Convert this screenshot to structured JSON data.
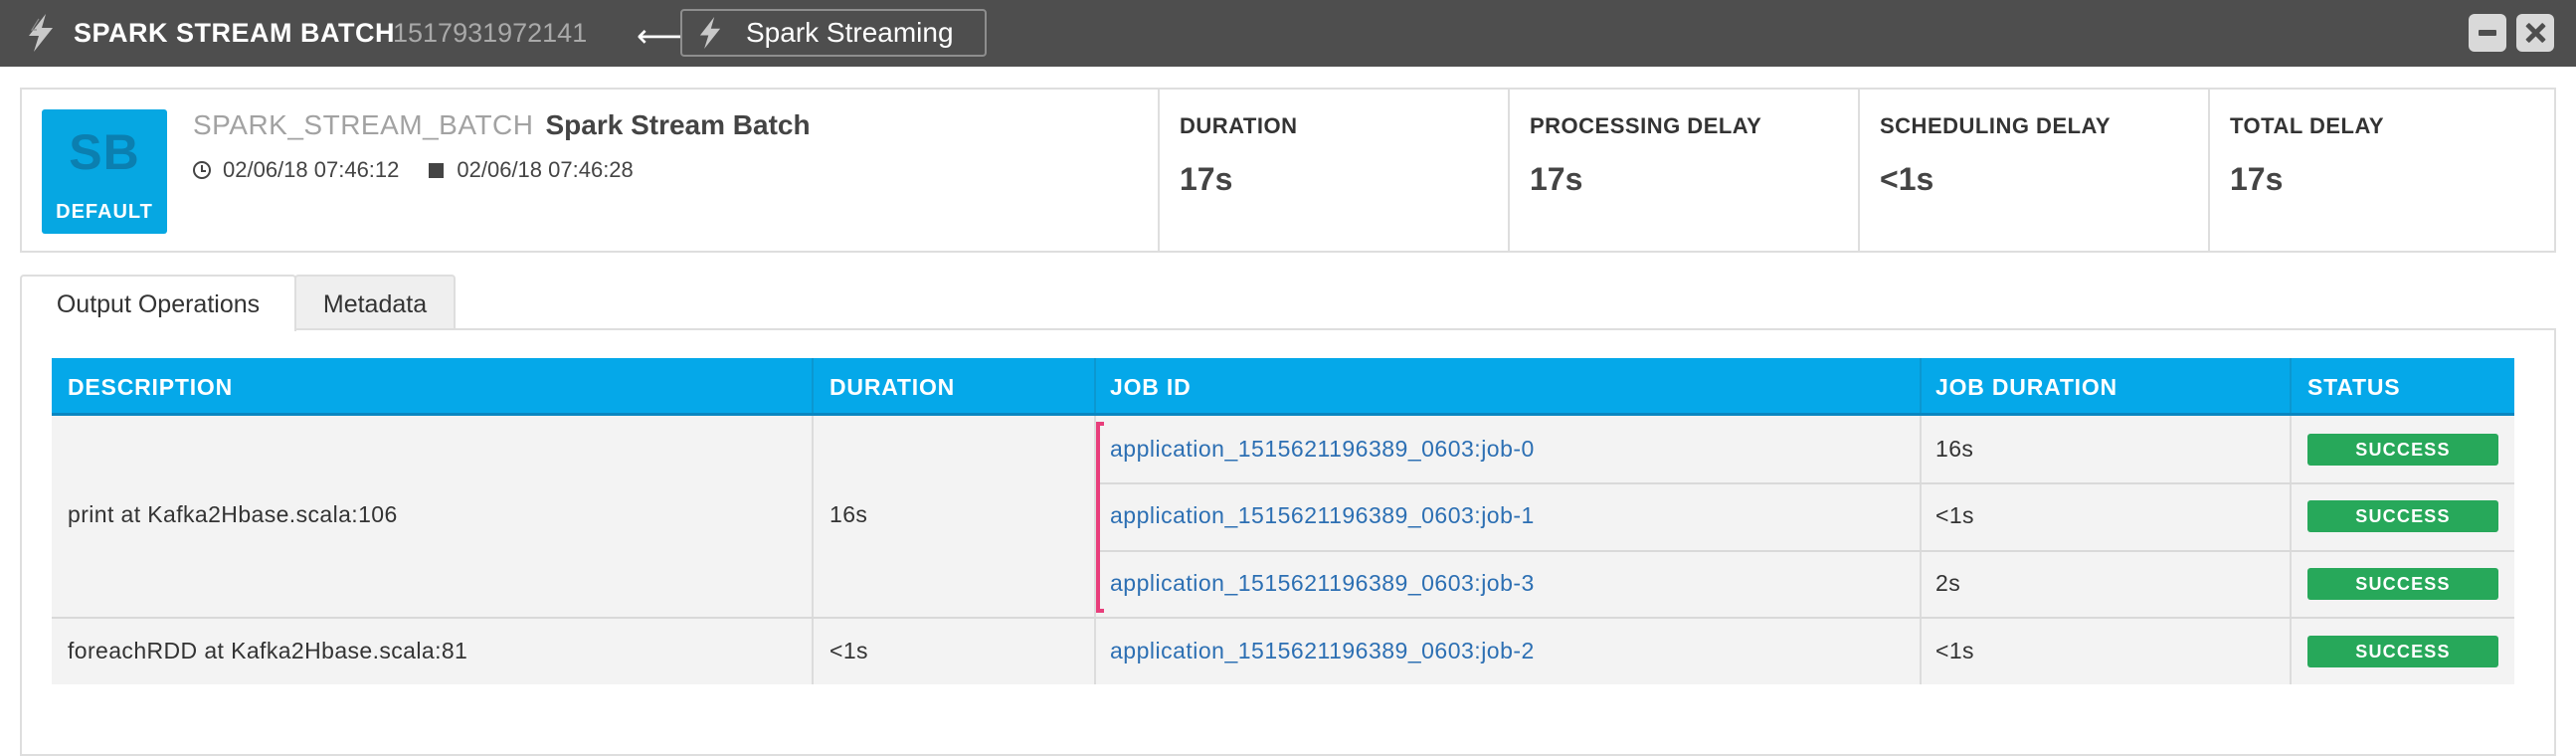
{
  "window": {
    "app_icon": "lightning-bolt-icon",
    "title": "SPARK STREAM BATCH",
    "id": "1517931972141",
    "back_arrow": "⟵",
    "parent_label": "Spark Streaming",
    "minimize_icon": "minimize-icon",
    "close_icon": "close-icon"
  },
  "summary": {
    "badge_initials": "SB",
    "badge_env": "DEFAULT",
    "badge_color": "#06a7e2",
    "type": "SPARK_STREAM_BATCH",
    "name": "Spark Stream Batch",
    "start_time": "02/06/18 07:46:12",
    "end_time": "02/06/18 07:46:28",
    "metrics": [
      {
        "label": "DURATION",
        "value": "17s"
      },
      {
        "label": "PROCESSING DELAY",
        "value": "17s"
      },
      {
        "label": "SCHEDULING DELAY",
        "value": "<1s"
      },
      {
        "label": "TOTAL DELAY",
        "value": "17s"
      }
    ]
  },
  "tabs": [
    {
      "label": "Output Operations",
      "active": true
    },
    {
      "label": "Metadata",
      "active": false
    }
  ],
  "table": {
    "header_color": "#05a8e9",
    "columns": [
      "DESCRIPTION",
      "DURATION",
      "JOB ID",
      "JOB DURATION",
      "STATUS"
    ],
    "groups": [
      {
        "description": "print at Kafka2Hbase.scala:106",
        "duration": "16s",
        "jobs": [
          {
            "job_id": "application_1515621196389_0603:job-0",
            "job_duration": "16s",
            "status": "SUCCESS"
          },
          {
            "job_id": "application_1515621196389_0603:job-1",
            "job_duration": "<1s",
            "status": "SUCCESS"
          },
          {
            "job_id": "application_1515621196389_0603:job-3",
            "job_duration": "2s",
            "status": "SUCCESS"
          }
        ]
      },
      {
        "description": "foreachRDD at Kafka2Hbase.scala:81",
        "duration": "<1s",
        "jobs": [
          {
            "job_id": "application_1515621196389_0603:job-2",
            "job_duration": "<1s",
            "status": "SUCCESS"
          }
        ]
      }
    ],
    "status_color": "#27a85a",
    "group_highlight_color": "#e83e7b"
  }
}
